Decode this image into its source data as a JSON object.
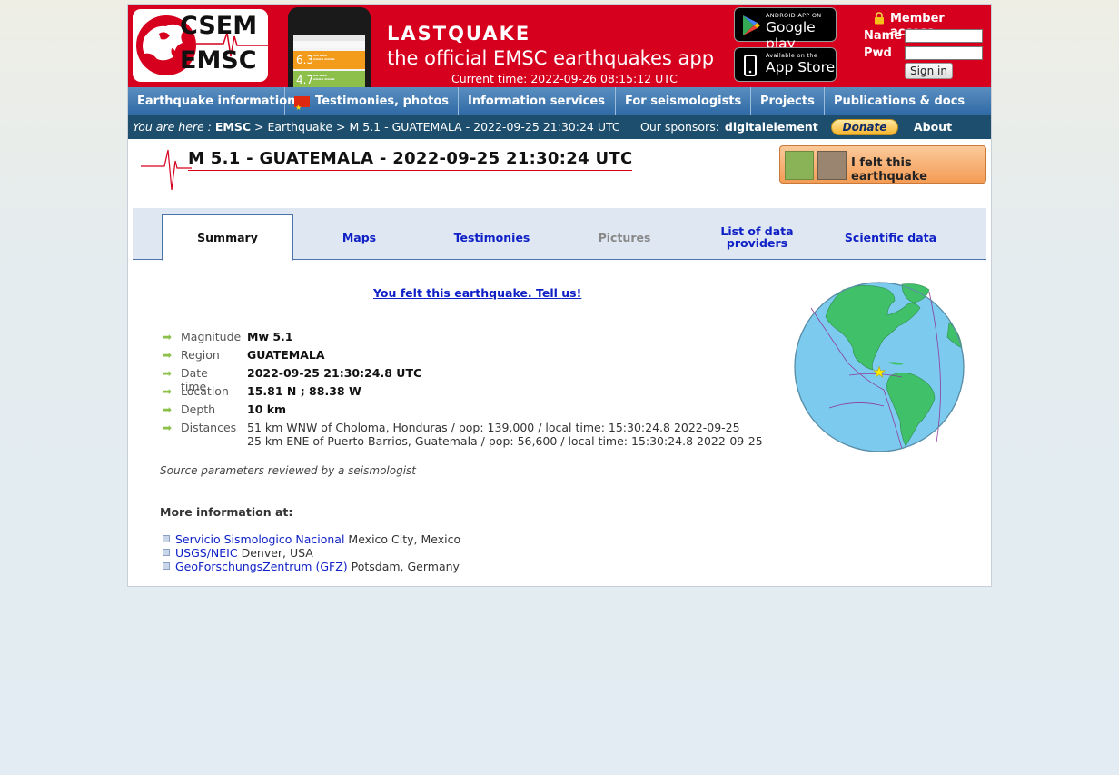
{
  "header": {
    "logo_line1": "CSEM",
    "logo_line2": "EMSC",
    "banner_title": "LASTQUAKE",
    "banner_subtitle": "the official EMSC earthquakes app",
    "current_time": "Current time: 2022-09-26 08:15:12 UTC",
    "phone_mag1": "6.3",
    "phone_mag2": "4.7",
    "google_play_small": "ANDROID APP ON",
    "google_play_big": "Google play",
    "app_store_small": "Available on the",
    "app_store_big": "App Store",
    "member_access": "Member access",
    "name_label": "Name",
    "pwd_label": "Pwd",
    "sign_in": "Sign in"
  },
  "nav": {
    "items": [
      {
        "label": "Earthquake information"
      },
      {
        "label": "Testimonies, photos"
      },
      {
        "label": "Information services"
      },
      {
        "label": "For seismologists"
      },
      {
        "label": "Projects"
      },
      {
        "label": "Publications & docs"
      }
    ]
  },
  "breadcrumb": {
    "prefix": "You are here :",
    "emsc": "EMSC",
    "sep1": ">",
    "earthquake": "Earthquake",
    "sep2": ">",
    "current": "M 5.1 - GUATEMALA - 2022-09-25 21:30:24 UTC",
    "sponsors_label": "Our sponsors:",
    "sponsor_name": "digitalelement",
    "donate": "Donate",
    "about": "About EMSC"
  },
  "event": {
    "title": "M 5.1 - GUATEMALA - 2022-09-25 21:30:24 UTC",
    "felt_button": "I felt this earthquake"
  },
  "tabs": [
    {
      "label": "Summary",
      "state": "active"
    },
    {
      "label": "Maps",
      "state": "normal"
    },
    {
      "label": "Testimonies",
      "state": "normal"
    },
    {
      "label": "Pictures",
      "state": "disabled"
    },
    {
      "label": "List of data providers",
      "state": "normal"
    },
    {
      "label": "Scientific data",
      "state": "normal"
    }
  ],
  "summary": {
    "tell_us": "You felt this earthquake. Tell us!",
    "rows": [
      {
        "label": "Magnitude",
        "value": "Mw 5.1"
      },
      {
        "label": "Region",
        "value": "GUATEMALA"
      },
      {
        "label": "Date time",
        "value": "2022-09-25 21:30:24.8 UTC"
      },
      {
        "label": "Location",
        "value": "15.81 N ; 88.38 W"
      },
      {
        "label": "Depth",
        "value": "10 km"
      }
    ],
    "distances_label": "Distances",
    "distances": [
      "51 km WNW of Choloma, Honduras / pop: 139,000 / local time: 15:30:24.8 2022-09-25",
      "25 km ENE of Puerto Barrios, Guatemala / pop: 56,600 / local time: 15:30:24.8 2022-09-25"
    ],
    "source_note": "Source parameters reviewed by a seismologist",
    "more_info": "More information at:",
    "providers": [
      {
        "name": "Servicio Sismologico Nacional",
        "location": "Mexico City, Mexico"
      },
      {
        "name": "USGS/NEIC",
        "location": "Denver, USA"
      },
      {
        "name": "GeoForschungsZentrum (GFZ)",
        "location": "Potsdam, Germany"
      }
    ]
  },
  "colors": {
    "header_red": "#d6001e",
    "nav_blue": "#2f6aa5",
    "crumb_dark": "#1d4e6e",
    "link_blue": "#0f20c6",
    "arrow_green": "#8cc04a"
  }
}
